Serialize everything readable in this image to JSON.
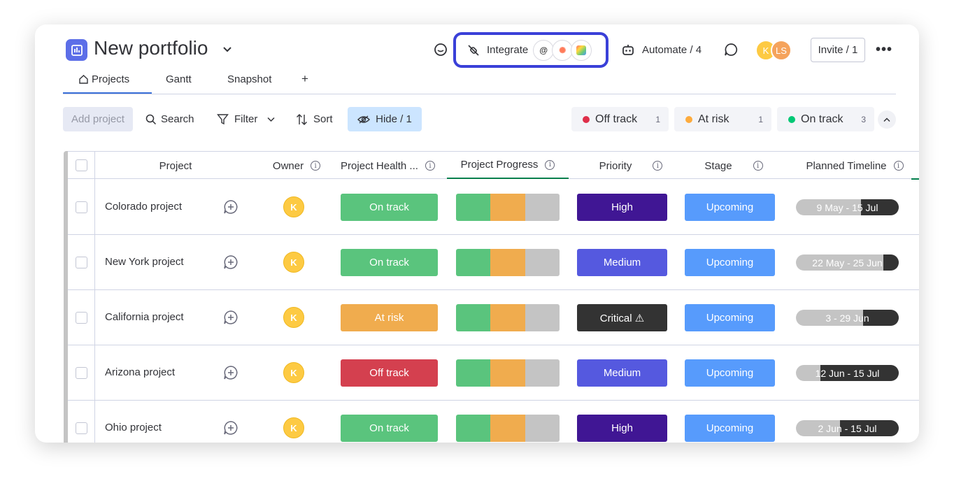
{
  "header": {
    "title": "New portfolio",
    "integrate_label": "Integrate",
    "automate_label": "Automate / 4",
    "avatars": [
      {
        "initials": "K",
        "color": "#fdca43"
      },
      {
        "initials": "LS",
        "color": "#f5a35c"
      }
    ],
    "invite_label": "Invite / 1",
    "more_label": "•••"
  },
  "tabs": [
    {
      "label": "Projects",
      "active": true,
      "icon": "home-icon"
    },
    {
      "label": "Gantt",
      "active": false
    },
    {
      "label": "Snapshot",
      "active": false
    },
    {
      "label": "+",
      "active": false
    }
  ],
  "toolbar": {
    "add_project": "Add project",
    "search": "Search",
    "filter": "Filter",
    "sort": "Sort",
    "hide": "Hide / 1"
  },
  "status_summary": [
    {
      "label": "Off track",
      "count": "1",
      "color": "#df2f4a"
    },
    {
      "label": "At risk",
      "count": "1",
      "color": "#fdab3d"
    },
    {
      "label": "On track",
      "count": "3",
      "color": "#00c875"
    }
  ],
  "columns": {
    "project": "Project",
    "owner": "Owner",
    "health": "Project Health ...",
    "progress": "Project Progress",
    "priority": "Priority",
    "stage": "Stage",
    "timeline": "Planned Timeline",
    "info_glyph": "i"
  },
  "rows": [
    {
      "name": "Colorado project",
      "owner": "K",
      "health": "On track",
      "health_color": "#5ac47d",
      "priority": "High",
      "priority_color": "#401694",
      "stage": "Upcoming",
      "timeline": "9 May - 15 Jul",
      "timeline_progress": 0.37
    },
    {
      "name": "New York project",
      "owner": "K",
      "health": "On track",
      "health_color": "#5ac47d",
      "priority": "Medium",
      "priority_color": "#5559df",
      "stage": "Upcoming",
      "timeline": "22 May - 25 Jun",
      "timeline_progress": 0.15
    },
    {
      "name": "California project",
      "owner": "K",
      "health": "At risk",
      "health_color": "#f0ac4e",
      "priority": "Critical ⚠",
      "priority_color": "#333333",
      "stage": "Upcoming",
      "timeline": "3 - 29 Jun",
      "timeline_progress": 0.35
    },
    {
      "name": "Arizona project",
      "owner": "K",
      "health": "Off track",
      "health_color": "#d4404f",
      "priority": "Medium",
      "priority_color": "#5559df",
      "stage": "Upcoming",
      "timeline": "12 Jun - 15 Jul",
      "timeline_progress": 0.76
    },
    {
      "name": "Ohio project",
      "owner": "K",
      "health": "On track",
      "health_color": "#5ac47d",
      "priority": "High",
      "priority_color": "#401694",
      "stage": "Upcoming",
      "timeline": "2 Jun - 15 Jul",
      "timeline_progress": 0.57
    }
  ],
  "progress_segments": [
    {
      "share": 0.333,
      "color": "#5ac47d"
    },
    {
      "share": 0.333,
      "color": "#f0ac4e"
    },
    {
      "share": 0.334,
      "color": "#c4c4c4"
    }
  ],
  "stage_color": "#579bfc"
}
